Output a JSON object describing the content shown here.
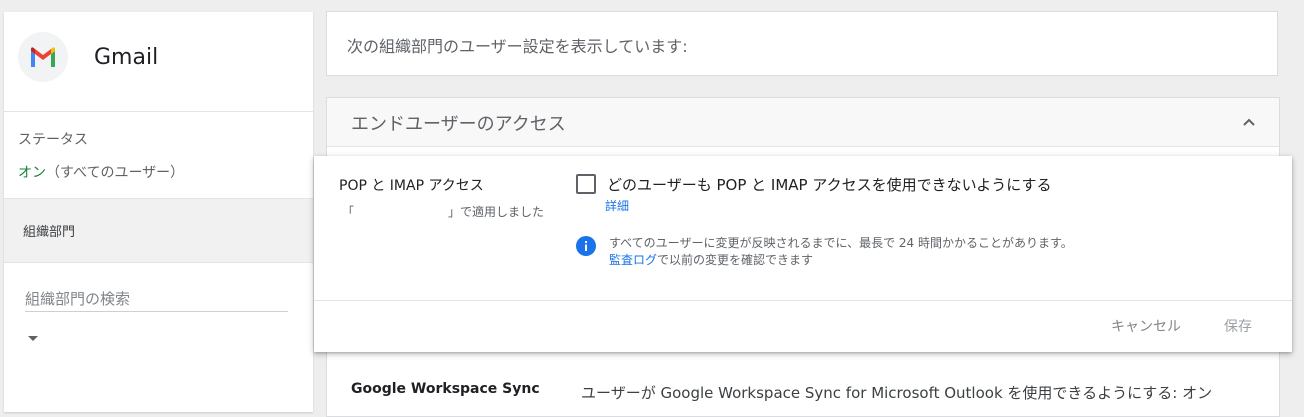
{
  "app": {
    "name": "Gmail",
    "logo_icon": "gmail-logo-icon"
  },
  "left": {
    "status_label": "ステータス",
    "status_on": "オン",
    "status_scope": "（すべてのユーザー）",
    "ou_label": "組織部門",
    "ou_search_placeholder": "組織部門の検索",
    "dropdown_icon": "caret-down-icon"
  },
  "header": {
    "info_text": "次の組織部門のユーザー設定を表示しています:"
  },
  "section": {
    "title": "エンドユーザーのアクセス",
    "collapse_icon": "chevron-up-icon",
    "sync_title": "Google Workspace Sync",
    "sync_desc": "ユーザーが Google Workspace Sync for Microsoft Outlook を使用できるようにする: オン"
  },
  "edit_card": {
    "setting_name": "POP と IMAP アクセス",
    "applied_open": "「",
    "applied_close": "」で適用しました",
    "checkbox_label": "どのユーザーも POP と IMAP アクセスを使用できないようにする",
    "checkbox_checked": false,
    "details_link": "詳細",
    "info_icon": "info-icon",
    "notice_line1": "すべてのユーザーに変更が反映されるまでに、最長で 24 時間かかることがあります。",
    "audit_log_link": "監査ログ",
    "notice_line2_rest": "で以前の変更を確認できます",
    "cancel_label": "キャンセル",
    "save_label": "保存"
  },
  "colors": {
    "status_on": "#188038",
    "link": "#1a73e8",
    "info_icon": "#1a73e8"
  }
}
